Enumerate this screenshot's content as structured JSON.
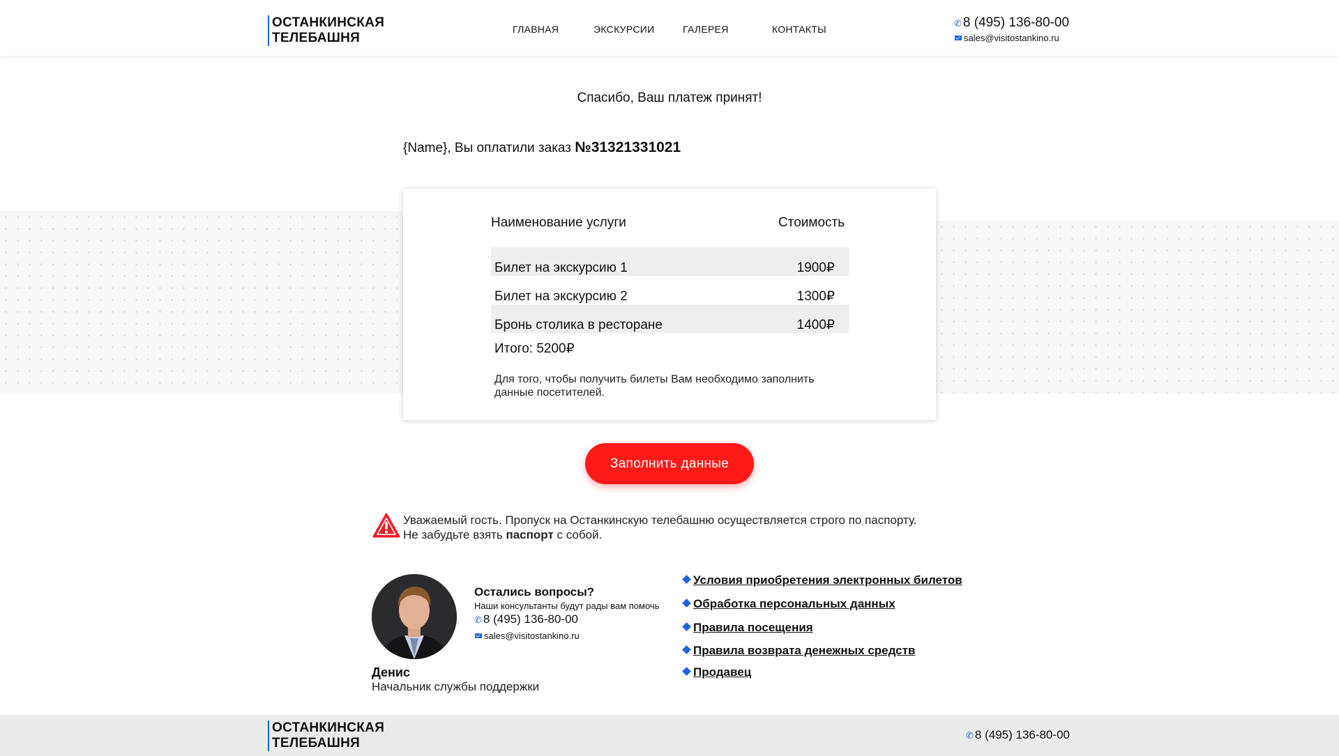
{
  "header": {
    "logo_line1": "ОСТАНКИНСКАЯ",
    "logo_line2": "ТЕЛЕБАШНЯ",
    "nav": [
      "ГЛАВНАЯ",
      "ЭКСКУРСИИ",
      "ГАЛЕРЕЯ",
      "КОНТАКТЫ"
    ],
    "phone": "8 (495) 136-80-00",
    "email": "sales@visitostankino.ru"
  },
  "main": {
    "thanks": "Спасибо, Ваш платеж принят!",
    "order_prefix": "{Name}, Вы оплатили заказ",
    "order_number": "№31321331021",
    "table": {
      "col_service": "Наименование услуги",
      "col_price": "Стоимость",
      "rows": [
        {
          "name": "Билет на экскурсию 1",
          "price": "1900₽"
        },
        {
          "name": "Билет на экскурсию 2",
          "price": "1300₽"
        },
        {
          "name": "Бронь столика в ресторане",
          "price": "1400₽"
        }
      ],
      "total": "Итого: 5200₽",
      "note": "Для того, чтобы получить билеты Вам необходимо заполнить данные посетителей."
    },
    "cta_label": "Заполнить данные",
    "warning": {
      "line1": "Уважаемый гость. Пропуск на Останкинскую телебашню осуществляется строго по паспорту.",
      "line2_before": "Не забудьте взять",
      "line2_bold": "паспорт",
      "line2_after": "с собой."
    }
  },
  "support": {
    "name": "Денис",
    "role": "Начальник службы поддержки",
    "question_title": "Остались вопросы?",
    "question_sub": "Наши консультанты будут рады вам помочь",
    "phone": "8 (495) 136-80-00",
    "email": "sales@visitostankino.ru"
  },
  "links": [
    "Условия приобретения электронных билетов",
    "Обработка персональных данных",
    "Правила посещения",
    "Правила возврата денежных средств",
    "Продавец"
  ],
  "footer": {
    "logo_line1": "ОСТАНКИНСКАЯ",
    "logo_line2": "ТЕЛЕБАШНЯ",
    "phone": "8 (495) 136-80-00"
  },
  "colors": {
    "accent_blue": "#1f63e0",
    "cta_red": "#ff1a1a",
    "warning_red": "#e8232a"
  }
}
